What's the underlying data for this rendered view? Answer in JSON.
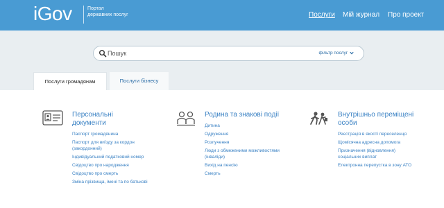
{
  "header": {
    "logo": "iGov",
    "tagline": "Портал державних послуг",
    "nav": [
      "Послуги",
      "Мій журнал",
      "Про проект"
    ]
  },
  "search": {
    "placeholder": "Пошук",
    "filter_label": "фільтр послуг"
  },
  "tabs": [
    "Послуги громадянам",
    "Послуги бізнесу"
  ],
  "categories": [
    {
      "title": "Персональні документи",
      "icon": "id-card-icon",
      "items": [
        "Паспорт громадянина",
        "Паспорт для виїзду за кордон (закордонний)",
        "Індивідуальний податковий номер",
        "Свідоцтво про народження",
        "Свідоцтво про смерть",
        "Зміна прізвища, імені та по батькові"
      ]
    },
    {
      "title": "Родина та знакові події",
      "icon": "family-icon",
      "items": [
        "Дитина",
        "Одруження",
        "Розлучення",
        "Люди з обмеженими можливостями (інваліди)",
        "Вихід на пенсію",
        "Смерть"
      ]
    },
    {
      "title": "Внутрішньо переміщені особи",
      "icon": "displaced-persons-icon",
      "items": [
        "Реєстрація в якості переселенця",
        "Щомісячна адресна допомога",
        "Призначення (відновлення) соціальних виплат",
        "Електронна перепустка в зону АТО"
      ]
    }
  ],
  "colors": {
    "header_bg": "#499bd3",
    "search_band_bg": "#e9eef1",
    "link": "#3b82c4"
  }
}
